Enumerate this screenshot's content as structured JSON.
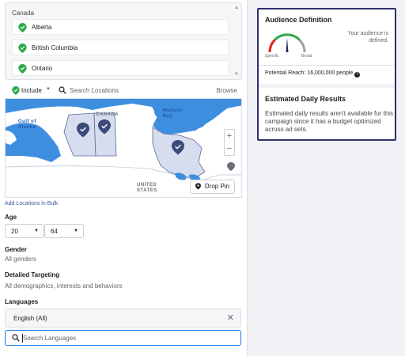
{
  "locations": {
    "country": "Canada",
    "items": [
      {
        "label": "Alberta"
      },
      {
        "label": "British Columbia"
      },
      {
        "label": "Ontario"
      }
    ],
    "include_label": "Include",
    "search_placeholder": "Search Locations",
    "browse_label": "Browse",
    "add_bulk_label": "Add Locations in Bulk"
  },
  "map": {
    "labels": {
      "hudson_bay": "Hudson\nBay",
      "canada": "CANADA",
      "gulf_of_alaska": "Gulf of\nAlaska",
      "united_states": "UNITED\nSTATES"
    },
    "zoom_in": "+",
    "zoom_out": "−",
    "drop_pin_label": "Drop Pin"
  },
  "age": {
    "label": "Age",
    "min": "20",
    "max": "64"
  },
  "gender": {
    "label": "Gender",
    "value": "All genders"
  },
  "detailed_targeting": {
    "label": "Detailed Targeting",
    "value": "All demographics, interests and behaviors"
  },
  "languages": {
    "label": "Languages",
    "selected": "English (All)",
    "search_placeholder": "Search Languages"
  },
  "audience": {
    "title": "Audience Definition",
    "gauge_left": "Specific",
    "gauge_right": "Broad",
    "message": "Your audience is defined.",
    "potential_reach": "Potential Reach: 16,000,000 people",
    "gauge_level": 0.5
  },
  "estimated": {
    "title": "Estimated Daily Results",
    "text": "Estimated daily results aren't available for this campaign since it has a budget optimized across ad sets."
  },
  "colors": {
    "pin_green": "#2ea84a",
    "accent_blue": "#1877f2",
    "card_border": "#2f2f6e",
    "map_water": "#3e8ee0",
    "map_land": "#ffffff",
    "map_selected": "#d6ddee"
  },
  "icons": {
    "pin": "location-pin-icon",
    "search": "search-icon",
    "close": "close-icon",
    "info": "info-icon",
    "caret": "caret-down-icon"
  }
}
